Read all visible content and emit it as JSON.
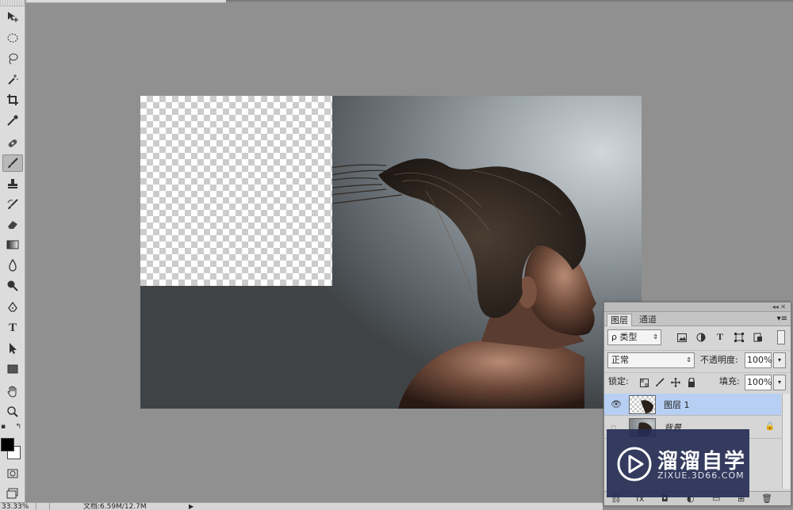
{
  "toolbar": {
    "tools": [
      {
        "id": "move",
        "icon": "move-icon"
      },
      {
        "id": "marquee",
        "icon": "ellipse-marquee-icon"
      },
      {
        "id": "lasso",
        "icon": "lasso-icon"
      },
      {
        "id": "magic-wand",
        "icon": "magic-wand-icon"
      },
      {
        "id": "crop",
        "icon": "crop-icon"
      },
      {
        "id": "eyedropper",
        "icon": "eyedropper-icon"
      },
      {
        "id": "healing",
        "icon": "healing-brush-icon"
      },
      {
        "id": "brush",
        "icon": "brush-icon",
        "active": true
      },
      {
        "id": "stamp",
        "icon": "clone-stamp-icon"
      },
      {
        "id": "history-brush",
        "icon": "history-brush-icon"
      },
      {
        "id": "eraser",
        "icon": "eraser-icon"
      },
      {
        "id": "gradient",
        "icon": "gradient-icon"
      },
      {
        "id": "blur",
        "icon": "blur-icon"
      },
      {
        "id": "dodge",
        "icon": "dodge-icon"
      },
      {
        "id": "pen",
        "icon": "pen-icon"
      },
      {
        "id": "type",
        "icon": "type-icon",
        "glyph": "T"
      },
      {
        "id": "path-select",
        "icon": "path-selection-icon"
      },
      {
        "id": "shape",
        "icon": "rectangle-shape-icon"
      },
      {
        "id": "hand",
        "icon": "hand-icon"
      },
      {
        "id": "zoom",
        "icon": "zoom-icon"
      }
    ],
    "foreground_color": "#000000",
    "background_color": "#ffffff"
  },
  "status": {
    "zoom": "33.33%",
    "doc_info": "文档:6.59M/12.7M",
    "arrow": "▶"
  },
  "layers_panel": {
    "collapse_glyph": "◂◂ ✕",
    "tabs": [
      {
        "label": "图层",
        "active": true
      },
      {
        "label": "通道",
        "active": false
      }
    ],
    "menu_glyph": "▾≡",
    "filter": {
      "search_glyph": "ρ",
      "label": "类型",
      "caret": "⇕"
    },
    "blend_mode": {
      "value": "正常",
      "caret": "⇕"
    },
    "opacity": {
      "label": "不透明度:",
      "value": "100%"
    },
    "lock_label": "锁定:",
    "fill": {
      "label": "填充:",
      "value": "100%"
    },
    "layers": [
      {
        "name": "图层 1",
        "visible": true,
        "selected": true
      },
      {
        "name": "背景",
        "visible": false,
        "locked": true
      }
    ]
  },
  "watermark": {
    "cn": "溜溜自学",
    "en": "ZIXUE.3D66.COM",
    "color": "#262e54"
  },
  "colors": {
    "workspace": "#909090",
    "selected_layer": "#b7cff3"
  }
}
